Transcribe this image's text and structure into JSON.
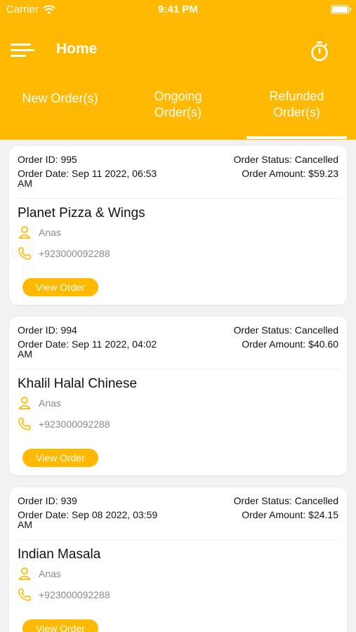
{
  "status_bar": {
    "carrier": "Carrier",
    "time": "9:41 PM"
  },
  "header": {
    "title": "Home"
  },
  "tabs": [
    {
      "label": "New Order(s)",
      "active": false
    },
    {
      "label_line1": "Ongoing",
      "label_line2": "Order(s)",
      "active": false
    },
    {
      "label_line1": "Refunded",
      "label_line2": "Order(s)",
      "active": true
    }
  ],
  "colors": {
    "accent": "#ffb901",
    "background": "#f2f2f2",
    "card": "#ffffff",
    "muted_text": "#8a8a8a"
  },
  "orders": [
    {
      "order_id": "Order ID: 995",
      "order_date": "Order Date: Sep 11 2022, 06:53",
      "order_date_line2": "AM",
      "order_status": "Order Status: Cancelled",
      "order_amount": "Order Amount: $59.23",
      "restaurant": "Planet Pizza & Wings",
      "customer": "Anas",
      "phone": "+923000092288",
      "button": "View Order"
    },
    {
      "order_id": "Order ID: 994",
      "order_date": "Order Date: Sep 11 2022, 04:02",
      "order_date_line2": "AM",
      "order_status": "Order Status: Cancelled",
      "order_amount": "Order Amount: $40.60",
      "restaurant": "Khalil Halal Chinese",
      "customer": "Anas",
      "phone": "+923000092288",
      "button": "View Order"
    },
    {
      "order_id": "Order ID: 939",
      "order_date": "Order Date: Sep 08 2022, 03:59",
      "order_date_line2": "AM",
      "order_status": "Order Status: Cancelled",
      "order_amount": "Order Amount: $24.15",
      "restaurant": "Indian Masala",
      "customer": "Anas",
      "phone": "+923000092288",
      "button": "View Order"
    }
  ],
  "icons": {
    "menu": "hamburger-icon",
    "timer": "stopwatch-icon",
    "user": "user-icon",
    "phone": "phone-icon",
    "wifi": "wifi-icon",
    "battery": "battery-icon"
  }
}
